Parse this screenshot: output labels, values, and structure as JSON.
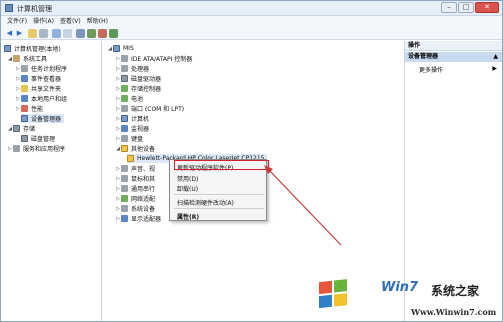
{
  "window": {
    "title": "计算机管理",
    "buttons": {
      "minimize": "–",
      "maximize": "□",
      "close": "✕"
    }
  },
  "menu": [
    "文件(F)",
    "操作(A)",
    "查看(V)",
    "帮助(H)"
  ],
  "left_tree": [
    {
      "label": "计算机管理(本地)",
      "icon": "computer-icon"
    },
    {
      "label": "系统工具",
      "icon": "tools-icon"
    },
    {
      "label": "任务计划程序",
      "icon": "clock-icon"
    },
    {
      "label": "事件查看器",
      "icon": "event-icon"
    },
    {
      "label": "共享文件夹",
      "icon": "folder-icon"
    },
    {
      "label": "本地用户和组",
      "icon": "users-icon"
    },
    {
      "label": "性能",
      "icon": "performance-icon"
    },
    {
      "label": "设备管理器",
      "icon": "device-manager-icon"
    },
    {
      "label": "存储",
      "icon": "storage-icon"
    },
    {
      "label": "磁盘管理",
      "icon": "disk-icon"
    },
    {
      "label": "服务和应用程序",
      "icon": "services-icon"
    }
  ],
  "device_tree": [
    {
      "label": "MIS",
      "icon": "computer-icon"
    },
    {
      "label": "IDE ATA/ATAPI 控制器",
      "icon": "ide-icon"
    },
    {
      "label": "处理器",
      "icon": "cpu-icon"
    },
    {
      "label": "磁盘驱动器",
      "icon": "disk-icon"
    },
    {
      "label": "存储控制器",
      "icon": "storage-controller-icon"
    },
    {
      "label": "电池",
      "icon": "battery-icon"
    },
    {
      "label": "端口 (COM 和 LPT)",
      "icon": "port-icon"
    },
    {
      "label": "计算机",
      "icon": "computer-icon"
    },
    {
      "label": "监视器",
      "icon": "monitor-icon"
    },
    {
      "label": "键盘",
      "icon": "keyboard-icon"
    },
    {
      "label": "其他设备",
      "icon": "other-devices-icon"
    },
    {
      "label": "Hewlett-Packard HP Color LaserJet CP1215",
      "icon": "warning-device-icon"
    },
    {
      "label": "声音、视",
      "icon": "sound-icon"
    },
    {
      "label": "鼠标和其",
      "icon": "mouse-icon"
    },
    {
      "label": "通用串行",
      "icon": "usb-icon"
    },
    {
      "label": "网络适配",
      "icon": "network-icon"
    },
    {
      "label": "系统设备",
      "icon": "system-icon"
    },
    {
      "label": "显示适配器",
      "icon": "display-icon"
    }
  ],
  "context_menu": [
    "更新驱动程序软件(P)...",
    "禁用(D)",
    "卸载(U)",
    "扫描检测硬件改动(A)",
    "属性(R)"
  ],
  "actions_pane": {
    "header": "操作",
    "section": "设备管理器",
    "more": "更多操作"
  },
  "watermark": {
    "brand": "Win7",
    "brand_cn": "系统之家",
    "site": "Www.Winwin7.com"
  },
  "colors": {
    "highlight": "#d21f2a",
    "selection": "#dbe8f7",
    "brand": "#2f6fb5"
  }
}
